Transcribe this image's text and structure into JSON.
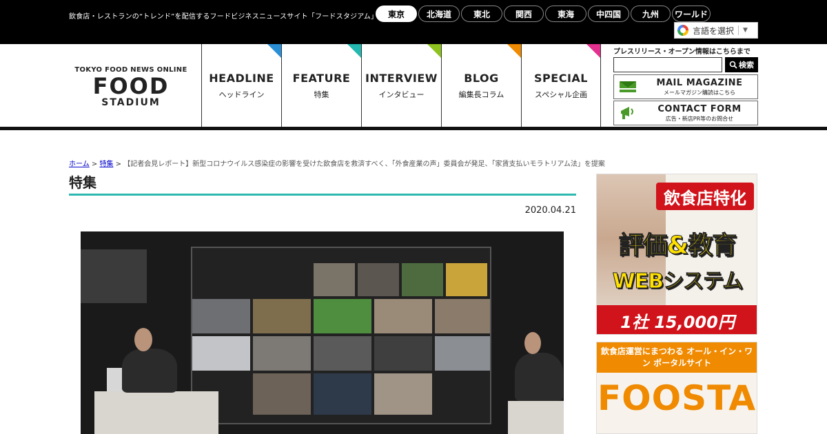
{
  "topbar": {
    "tagline": "飲食店・レストランの“トレンド”を配信するフードビジネスニュースサイト「フードスタジアム」",
    "regions": [
      {
        "label": "東京",
        "active": true
      },
      {
        "label": "北海道",
        "active": false
      },
      {
        "label": "東北",
        "active": false
      },
      {
        "label": "関西",
        "active": false
      },
      {
        "label": "東海",
        "active": false
      },
      {
        "label": "中四国",
        "active": false
      },
      {
        "label": "九州",
        "active": false
      },
      {
        "label": "ワールド",
        "active": false
      }
    ],
    "language_select": "言語を選択"
  },
  "logo": {
    "line1": "TOKYO FOOD NEWS ONLINE",
    "line2": "FOOD",
    "line3": "STADIUM"
  },
  "nav": [
    {
      "en": "HEADLINE",
      "jp": "ヘッドライン",
      "color": "#2a8fd6"
    },
    {
      "en": "FEATURE",
      "jp": "特集",
      "color": "#23b8b0"
    },
    {
      "en": "INTERVIEW",
      "jp": "インタビュー",
      "color": "#8dc21f"
    },
    {
      "en": "BLOG",
      "jp": "編集長コラム",
      "color": "#f08a00"
    },
    {
      "en": "SPECIAL",
      "jp": "スペシャル企画",
      "color": "#e4308e"
    }
  ],
  "sidebar_header": {
    "press_text": "プレスリリース・オープン情報はこちらまで",
    "search_placeholder": "",
    "search_button": "検索",
    "mail_title": "MAIL MAGAZINE",
    "mail_sub": "メールマガジン購読はこちら",
    "contact_title": "CONTACT FORM",
    "contact_sub": "広告・新店PR等のお問合せ"
  },
  "breadcrumb": {
    "home": "ホーム",
    "sep1": ">",
    "section": "特集",
    "sep2": ">",
    "current": "【記者会見レポート】新型コロナウイルス感染症の影響を受けた飲食店を救済すべく、「外食産業の声」委員会が発足、「家賃支払いモラトリアム法」を提案"
  },
  "page_title": "特集",
  "article": {
    "date": "2020.04.21"
  },
  "ads": {
    "ad1_line1": "飲食店特化",
    "ad1_line2": "評価&教育",
    "ad1_line3": "WEBシステム",
    "ad1_price": "1社 15,000円",
    "ad2_top": "飲食店運営にまつわる オール・イン・ワン ポータルサイト",
    "ad2_brand": "FOOSTA"
  }
}
